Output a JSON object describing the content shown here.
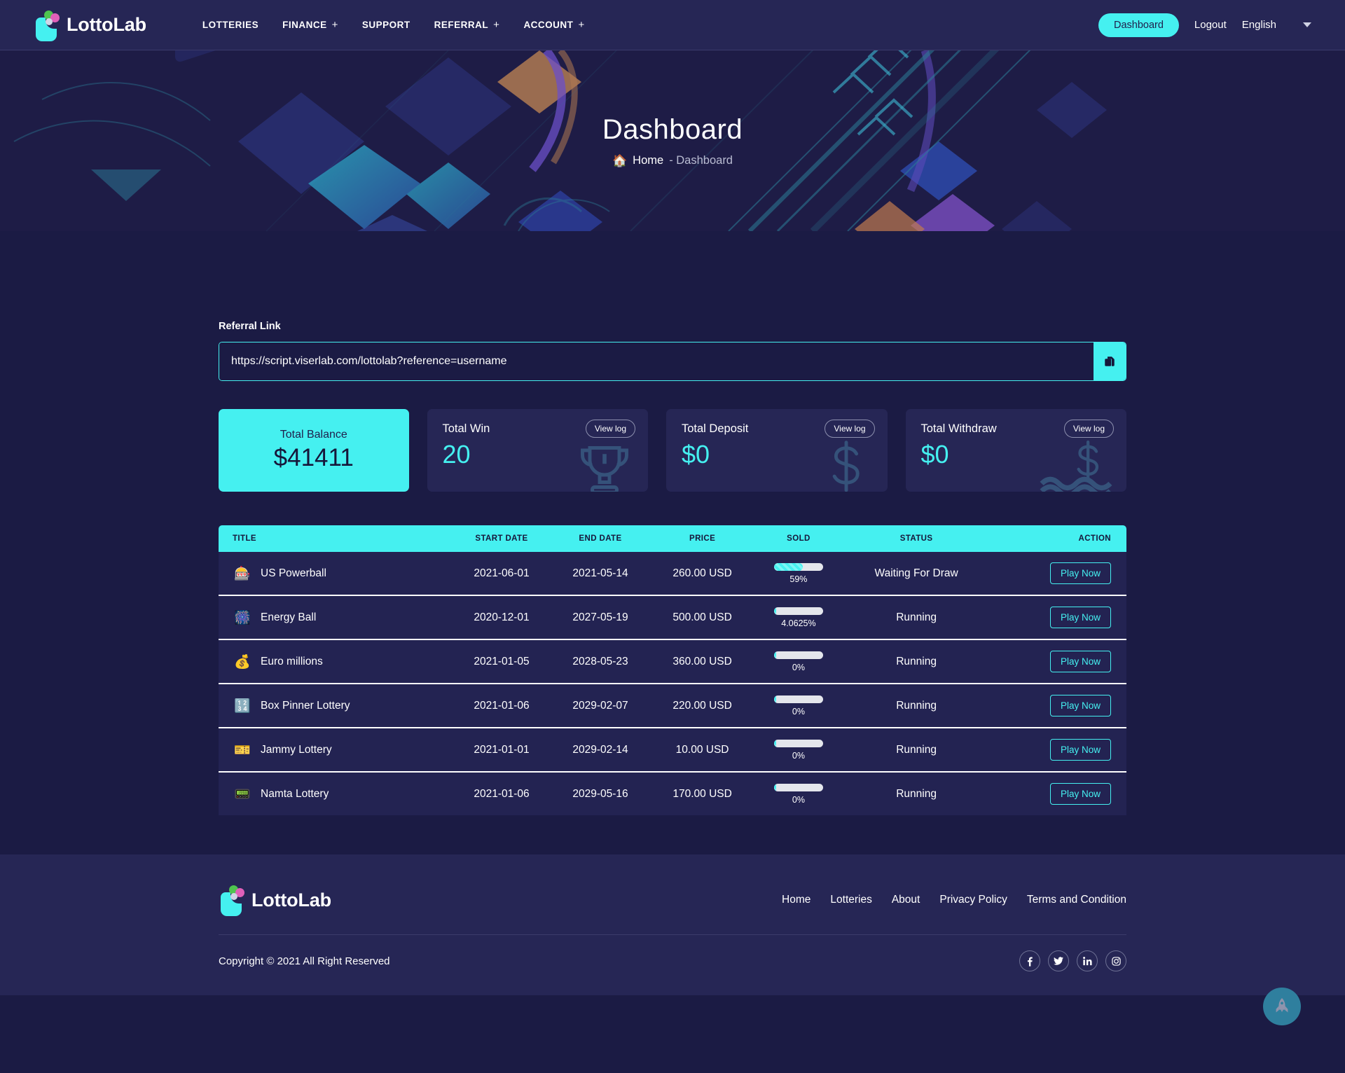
{
  "brand": {
    "name": "LottoLab"
  },
  "header": {
    "nav": [
      {
        "label": "LOTTERIES",
        "has_plus": false
      },
      {
        "label": "FINANCE",
        "has_plus": true
      },
      {
        "label": "SUPPORT",
        "has_plus": false
      },
      {
        "label": "REFERRAL",
        "has_plus": true
      },
      {
        "label": "ACCOUNT",
        "has_plus": true
      }
    ],
    "dashboard_button": "Dashboard",
    "logout": "Logout",
    "language": "English"
  },
  "hero": {
    "title": "Dashboard",
    "breadcrumb_home": "Home",
    "breadcrumb_current": "- Dashboard"
  },
  "referral": {
    "label": "Referral Link",
    "value": "https://script.viserlab.com/lottolab?reference=username",
    "placeholder": "https://script.viserlab.com/lottolab?reference=username"
  },
  "stats": [
    {
      "label": "Total Balance",
      "value": "$41411",
      "highlight": true,
      "view_log": null,
      "icon": null
    },
    {
      "label": "Total Win",
      "value": "20",
      "highlight": false,
      "view_log": "View log",
      "icon": "trophy-icon"
    },
    {
      "label": "Total Deposit",
      "value": "$0",
      "highlight": false,
      "view_log": "View log",
      "icon": "dollar-icon"
    },
    {
      "label": "Total Withdraw",
      "value": "$0",
      "highlight": false,
      "view_log": "View log",
      "icon": "dollar-wave-icon"
    }
  ],
  "table": {
    "columns": [
      "TITLE",
      "START DATE",
      "END DATE",
      "PRICE",
      "SOLD",
      "STATUS",
      "ACTION"
    ],
    "action_label": "Play Now",
    "rows": [
      {
        "icon": "🎰",
        "title": "US Powerball",
        "start": "2021-06-01",
        "end": "2021-05-14",
        "price": "260.00 USD",
        "sold_pct": "59%",
        "sold_value": 59,
        "status": "Waiting For Draw"
      },
      {
        "icon": "🎆",
        "title": "Energy Ball",
        "start": "2020-12-01",
        "end": "2027-05-19",
        "price": "500.00 USD",
        "sold_pct": "4.0625%",
        "sold_value": 4.0625,
        "status": "Running"
      },
      {
        "icon": "💰",
        "title": "Euro millions",
        "start": "2021-01-05",
        "end": "2028-05-23",
        "price": "360.00 USD",
        "sold_pct": "0%",
        "sold_value": 0,
        "status": "Running"
      },
      {
        "icon": "🔢",
        "title": "Box Pinner Lottery",
        "start": "2021-01-06",
        "end": "2029-02-07",
        "price": "220.00 USD",
        "sold_pct": "0%",
        "sold_value": 0,
        "status": "Running"
      },
      {
        "icon": "🎫",
        "title": "Jammy Lottery",
        "start": "2021-01-01",
        "end": "2029-02-14",
        "price": "10.00 USD",
        "sold_pct": "0%",
        "sold_value": 0,
        "status": "Running"
      },
      {
        "icon": "📟",
        "title": "Namta Lottery",
        "start": "2021-01-06",
        "end": "2029-05-16",
        "price": "170.00 USD",
        "sold_pct": "0%",
        "sold_value": 0,
        "status": "Running"
      }
    ]
  },
  "footer": {
    "links": [
      "Home",
      "Lotteries",
      "About",
      "Privacy Policy",
      "Terms and Condition"
    ],
    "copyright": "Copyright © 2021 All Right Reserved",
    "socials": [
      "facebook-icon",
      "twitter-icon",
      "linkedin-icon",
      "instagram-icon"
    ]
  },
  "colors": {
    "accent": "#45f0f0",
    "page_bg": "#1b1b44",
    "panel_bg": "#262655",
    "row_bg": "#232352"
  }
}
